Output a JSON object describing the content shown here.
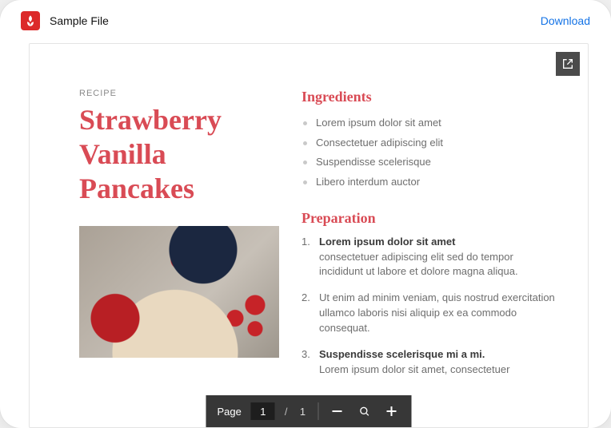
{
  "header": {
    "file_title": "Sample File",
    "download_label": "Download"
  },
  "document": {
    "category_label": "RECIPE",
    "title": "Strawberry Vanilla Pancakes",
    "image_alt": "strawberries-pancakes-photo",
    "ingredients": {
      "heading": "Ingredients",
      "items": [
        "Lorem ipsum dolor sit amet",
        "Consectetuer adipiscing elit",
        "Suspendisse scelerisque",
        "Libero interdum auctor"
      ]
    },
    "preparation": {
      "heading": "Preparation",
      "steps": [
        {
          "head": "Lorem ipsum dolor sit amet",
          "body": "consectetuer adipiscing elit sed do tempor incididunt ut labore et dolore magna aliqua."
        },
        {
          "head": "",
          "body": "Ut enim ad minim veniam, quis nostrud exercitation ullamco laboris nisi aliquip ex ea commodo consequat."
        },
        {
          "head": "Suspendisse scelerisque mi a mi.",
          "body": "Lorem ipsum dolor sit amet, consectetuer"
        }
      ]
    }
  },
  "toolbar": {
    "page_label": "Page",
    "current_page": "1",
    "separator": "/",
    "total_pages": "1"
  },
  "icons": {
    "pdf": "pdf-app-icon",
    "expand": "open-external-icon",
    "zoom_out": "zoom-out-icon",
    "fit": "fit-page-icon",
    "zoom_in": "zoom-in-icon"
  },
  "colors": {
    "accent": "#d94b55",
    "link": "#1473e6",
    "pdf_red": "#dc2a2a"
  }
}
